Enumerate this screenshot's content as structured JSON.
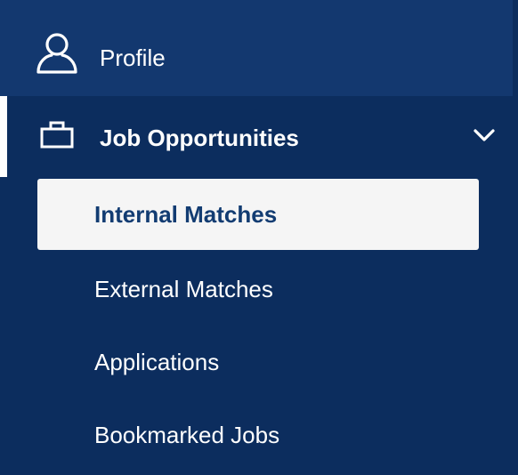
{
  "nav": {
    "profile": {
      "label": "Profile",
      "icon": "user-icon"
    },
    "job_opportunities": {
      "label": "Job Opportunities",
      "icon": "briefcase-icon",
      "expanded": true,
      "items": [
        {
          "label": "Internal Matches",
          "selected": true
        },
        {
          "label": "External Matches",
          "selected": false
        },
        {
          "label": "Applications",
          "selected": false
        },
        {
          "label": "Bookmarked Jobs",
          "selected": false
        }
      ]
    }
  },
  "colors": {
    "sidebar_bg": "#0c2d5e",
    "profile_bg": "#13386f",
    "selected_bg": "#f5f5f5",
    "selected_text": "#123c72",
    "text": "#ffffff"
  }
}
